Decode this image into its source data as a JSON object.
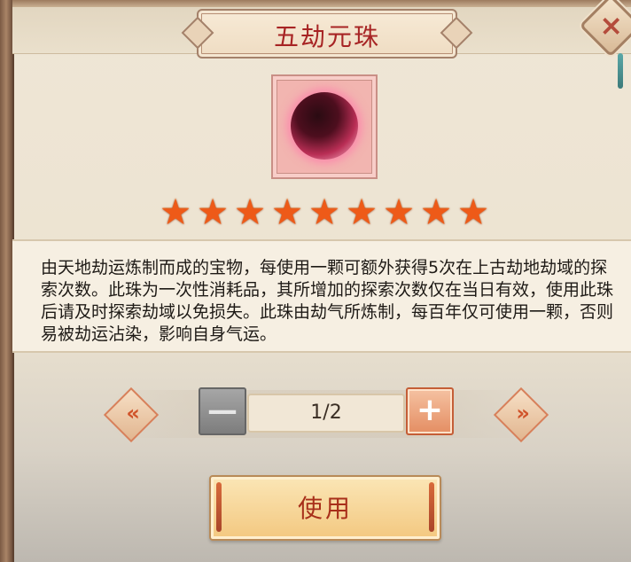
{
  "dialog": {
    "title": "五劫元珠",
    "close_icon": "close-icon"
  },
  "item": {
    "icon": "pearl-orb-icon",
    "stars": 9,
    "description": "由天地劫运炼制而成的宝物，每使用一颗可额外获得5次在上古劫地劫域的探索次数。此珠为一次性消耗品，其所增加的探索次数仅在当日有效，使用此珠后请及时探索劫域以免损失。此珠由劫气所炼制，每百年仅可使用一颗，否则易被劫运沾染，影响自身气运。"
  },
  "quantity": {
    "value": "1/2",
    "minus_glyph": "—",
    "plus_glyph": "+",
    "prev_glyph": "«",
    "next_glyph": "»"
  },
  "actions": {
    "use_label": "使用"
  },
  "colors": {
    "title": "#a72424",
    "star": "#ee5a18",
    "button_accent": "#e48d62"
  }
}
